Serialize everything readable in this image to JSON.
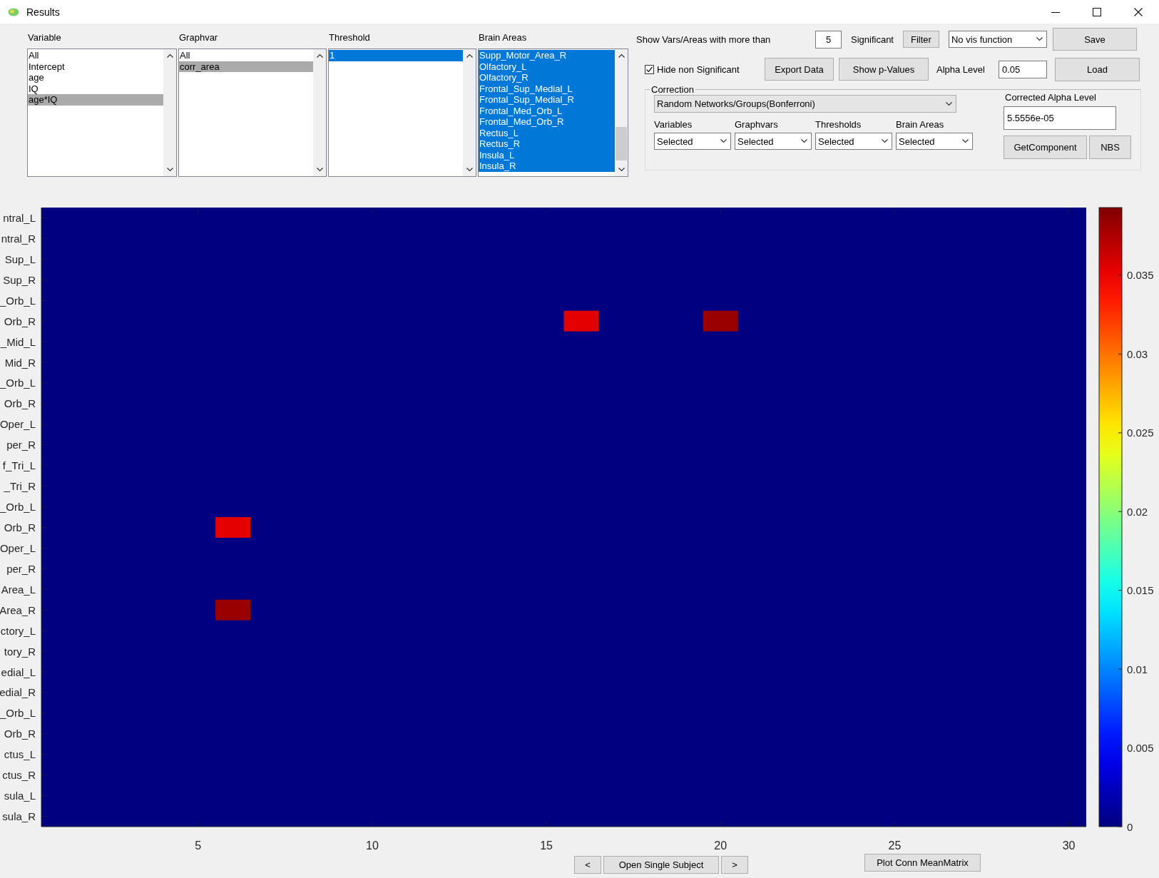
{
  "window": {
    "title": "Results"
  },
  "lists": [
    {
      "label": "Variable",
      "focused": false,
      "scroll_thumb": false,
      "items": [
        {
          "text": "All",
          "selected": false
        },
        {
          "text": "Intercept",
          "selected": false
        },
        {
          "text": "age",
          "selected": false
        },
        {
          "text": "IQ",
          "selected": false
        },
        {
          "text": "age*IQ",
          "selected": true
        }
      ]
    },
    {
      "label": "Graphvar",
      "focused": false,
      "scroll_thumb": false,
      "items": [
        {
          "text": "All",
          "selected": false
        },
        {
          "text": "corr_area",
          "selected": true
        }
      ]
    },
    {
      "label": "Threshold",
      "focused": true,
      "scroll_thumb": false,
      "items": [
        {
          "text": "1",
          "selected": true
        }
      ]
    },
    {
      "label": "Brain Areas",
      "focused": true,
      "scroll_thumb": true,
      "items": [
        {
          "text": "Supp_Motor_Area_R",
          "selected": true
        },
        {
          "text": "Olfactory_L",
          "selected": true
        },
        {
          "text": "Olfactory_R",
          "selected": true
        },
        {
          "text": "Frontal_Sup_Medial_L",
          "selected": true
        },
        {
          "text": "Frontal_Sup_Medial_R",
          "selected": true
        },
        {
          "text": "Frontal_Med_Orb_L",
          "selected": true
        },
        {
          "text": "Frontal_Med_Orb_R",
          "selected": true
        },
        {
          "text": "Rectus_L",
          "selected": true
        },
        {
          "text": "Rectus_R",
          "selected": true
        },
        {
          "text": "Insula_L",
          "selected": true
        },
        {
          "text": "Insula_R",
          "selected": true
        }
      ]
    }
  ],
  "filter": {
    "label": "Show Vars/Areas with more than",
    "count": "5",
    "unit_label": "Significant",
    "button": "Filter"
  },
  "vis_function": {
    "value": "No vis function"
  },
  "save_button": "Save",
  "hide_non_significant": {
    "label": "Hide non Significant",
    "checked": true
  },
  "export_button": "Export Data",
  "pvalues_button": "Show p-Values",
  "alpha": {
    "label": "Alpha Level",
    "value": "0.05"
  },
  "load_button": "Load",
  "correction": {
    "title": "Correction",
    "method": "Random Networks/Groups(Bonferroni)",
    "scopes": [
      {
        "label": "Variables",
        "value": "Selected"
      },
      {
        "label": "Graphvars",
        "value": "Selected"
      },
      {
        "label": "Thresholds",
        "value": "Selected"
      },
      {
        "label": "Brain Areas",
        "value": "Selected"
      }
    ],
    "corrected_alpha": {
      "label": "Corrected Alpha Level",
      "value": "5.5556e-05"
    },
    "buttons": [
      "GetComponent",
      "NBS"
    ]
  },
  "heatmap": {
    "column_ticks": [
      "5",
      "10",
      "15",
      "20",
      "25",
      "30"
    ],
    "row_labels": [
      "ntral_L",
      "ntral_R",
      "Sup_L",
      "Sup_R",
      "_Orb_L",
      "Orb_R",
      "_Mid_L",
      "Mid_R",
      "_Orb_L",
      "Orb_R",
      "Oper_L",
      "per_R",
      "f_Tri_L",
      "_Tri_R",
      "_Orb_L",
      "Orb_R",
      "Oper_L",
      "per_R",
      "Area_L",
      "Area_R",
      "ctory_L",
      "tory_R",
      "edial_L",
      "edial_R",
      "_Orb_L",
      "Orb_R",
      "ctus_L",
      "ctus_R",
      "sula_L",
      "sula_R"
    ],
    "colorbar_ticks": [
      "0.035",
      "0.03",
      "0.025",
      "0.02",
      "0.015",
      "0.01",
      "0.005",
      "0"
    ]
  },
  "nav": {
    "prev": "<",
    "open": "Open Single Subject",
    "next": ">"
  },
  "plot_button": "Plot Conn MeanMatrix"
}
